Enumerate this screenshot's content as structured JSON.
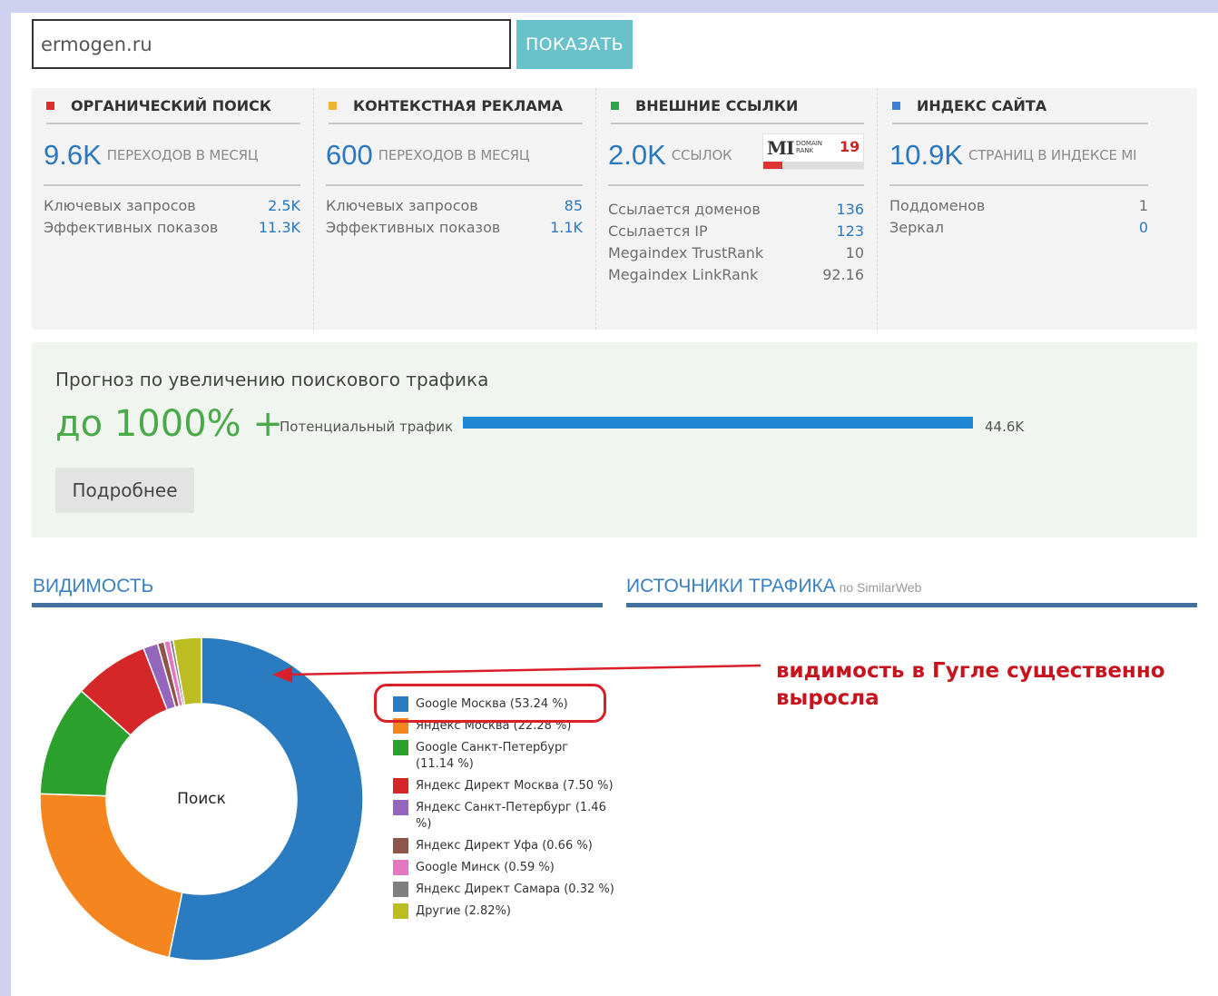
{
  "search": {
    "value": "ermogen.ru",
    "button_label": "ПОКАЗАТЬ"
  },
  "stats": [
    {
      "title": "ОРГАНИЧЕСКИЙ ПОИСК",
      "color": "#d9302f",
      "big": "9.6K",
      "unit": "ПЕРЕХОДОВ В МЕСЯЦ",
      "rows": [
        {
          "label": "Ключевых запросов",
          "value": "2.5K"
        },
        {
          "label": "Эффективных показов",
          "value": "11.3K"
        }
      ]
    },
    {
      "title": "КОНТЕКСТНАЯ РЕКЛАМА",
      "color": "#f2b233",
      "big": "600",
      "unit": "ПЕРЕХОДОВ В МЕСЯЦ",
      "rows": [
        {
          "label": "Ключевых запросов",
          "value": "85"
        },
        {
          "label": "Эффективных показов",
          "value": "1.1K"
        }
      ]
    },
    {
      "title": "ВНЕШНИЕ ССЫЛКИ",
      "color": "#2ea44f",
      "big": "2.0K",
      "unit": "ССЫЛОК",
      "badge": {
        "logo": "MI",
        "text_1": "DOMAIN",
        "text_2": "RANK",
        "value": "19",
        "fill": 0.19
      },
      "rows": [
        {
          "label": "Ссылается доменов",
          "value": "136"
        },
        {
          "label": "Ссылается IP",
          "value": "123"
        },
        {
          "label": "Megaindex TrustRank",
          "value": "10"
        },
        {
          "label": "Megaindex LinkRank",
          "value": "92.16"
        }
      ]
    },
    {
      "title": "ИНДЕКС САЙТА",
      "color": "#3d7fd4",
      "big": "10.9K",
      "unit": "СТРАНИЦ В ИНДЕКСЕ MI",
      "rows": [
        {
          "label": "Поддоменов",
          "value": "1"
        },
        {
          "label": "Зеркал",
          "value": "0"
        }
      ]
    }
  ],
  "forecast": {
    "title": "Прогноз по увеличению поискового трафика",
    "big": "до 1000% +",
    "bar_label": "Потенциальный трафик",
    "bar_value": "44.6K",
    "button_label": "Подробнее"
  },
  "visibility": {
    "title": "ВИДИМОСТЬ",
    "center_label": "Поиск"
  },
  "traffic_sources": {
    "title": "ИСТОЧНИКИ ТРАФИКА",
    "subtitle": "по SimilarWeb"
  },
  "annotation": "видимость в Гугле существенно выросла",
  "chart_data": {
    "type": "pie",
    "donut": true,
    "slices": [
      {
        "label": "Google Москва (53.24 %)",
        "value": 53.24,
        "color": "#2a7bbf"
      },
      {
        "label": "Яндекс Москва (22.28 %)",
        "value": 22.28,
        "color": "#f5861f"
      },
      {
        "label": "Google Санкт-Петербург (11.14 %)",
        "value": 11.14,
        "color": "#2ca02c"
      },
      {
        "label": "Яндекс Директ Москва (7.50 %)",
        "value": 7.5,
        "color": "#d62728"
      },
      {
        "label": "Яндекс Санкт-Петербург (1.46 %)",
        "value": 1.46,
        "color": "#9467bd"
      },
      {
        "label": "Яндекс Директ Уфа (0.66 %)",
        "value": 0.66,
        "color": "#8c564b"
      },
      {
        "label": "Google Минск (0.59 %)",
        "value": 0.59,
        "color": "#e377c2"
      },
      {
        "label": "Яндекс Директ Самара (0.32 %)",
        "value": 0.32,
        "color": "#7f7f7f"
      },
      {
        "label": "Другие (2.82%)",
        "value": 2.82,
        "color": "#bcbd22"
      }
    ]
  }
}
